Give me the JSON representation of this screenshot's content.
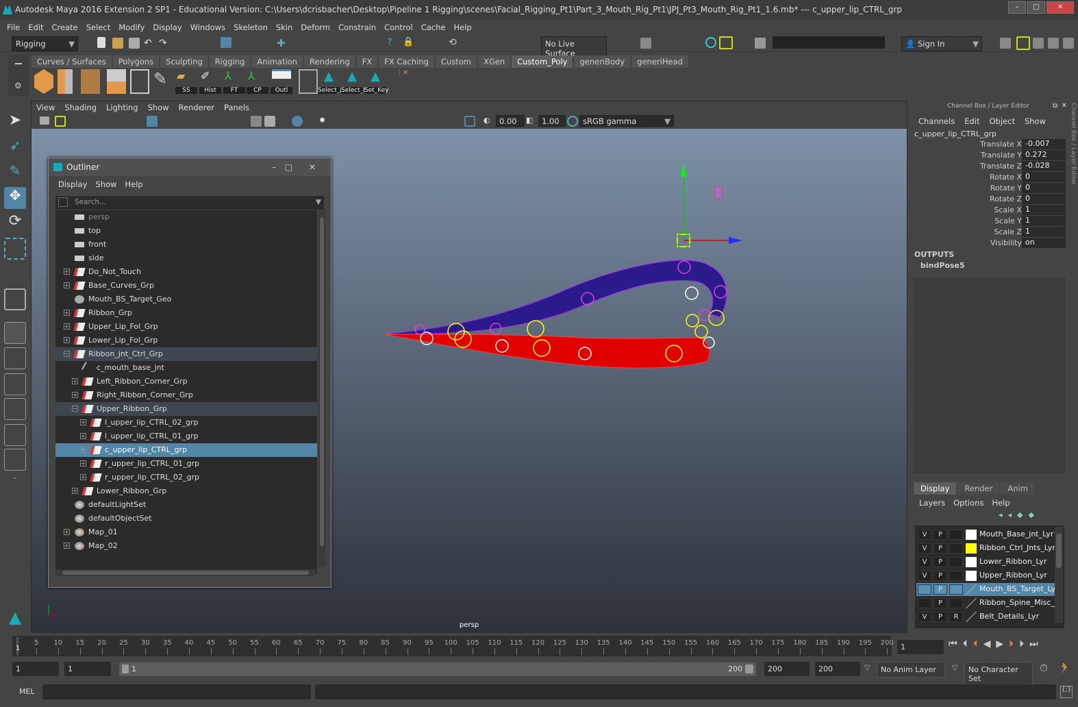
{
  "title": "Autodesk Maya 2016 Extension 2 SP1 - Educational Version: C:\\Users\\dcrisbacher\\Desktop\\Pipeline 1 Rigging\\scenes\\Facial_Rigging_Pt1\\Part_3_Mouth_Rig_Pt1\\JPJ_Pt3_Mouth_Rig_Pt1_1.6.mb*  ---  c_upper_lip_CTRL_grp",
  "menu": [
    "File",
    "Edit",
    "Create",
    "Select",
    "Modify",
    "Display",
    "Windows",
    "Skeleton",
    "Skin",
    "Deform",
    "Constrain",
    "Control",
    "Cache",
    "Help"
  ],
  "status": {
    "mode": "Rigging",
    "live_surface": "No Live Surface",
    "sign_in": "Sign In"
  },
  "shelf_tabs": [
    "Curves / Surfaces",
    "Polygons",
    "Sculpting",
    "Rigging",
    "Animation",
    "Rendering",
    "FX",
    "FX Caching",
    "Custom",
    "XGen",
    "Custom_Poly",
    "generiBody",
    "generiHead"
  ],
  "shelf_active": "Custom_Poly",
  "shelf_labels": [
    "SS",
    "Hist",
    "FT",
    "CP",
    "Outl",
    "Select_/",
    "Select_I",
    "Set_Key"
  ],
  "viewport": {
    "menu": [
      "View",
      "Shading",
      "Lighting",
      "Show",
      "Renderer",
      "Panels"
    ],
    "exposure": "0.00",
    "gamma": "1.00",
    "color_space": "sRGB gamma",
    "camera": "persp"
  },
  "outliner": {
    "title": "Outliner",
    "menu": [
      "Display",
      "Show",
      "Help"
    ],
    "search_placeholder": "Search...",
    "items": [
      {
        "label": "persp",
        "level": 0,
        "type": "camera",
        "dim": true
      },
      {
        "label": "top",
        "level": 0,
        "type": "camera"
      },
      {
        "label": "front",
        "level": 0,
        "type": "camera"
      },
      {
        "label": "side",
        "level": 0,
        "type": "camera"
      },
      {
        "label": "Do_Not_Touch",
        "level": 0,
        "type": "group",
        "exp": "+"
      },
      {
        "label": "Base_Curves_Grp",
        "level": 0,
        "type": "group",
        "exp": "+"
      },
      {
        "label": "Mouth_BS_Target_Geo",
        "level": 0,
        "type": "mesh"
      },
      {
        "label": "Ribbon_Grp",
        "level": 0,
        "type": "group",
        "exp": "+"
      },
      {
        "label": "Upper_Lip_Fol_Grp",
        "level": 0,
        "type": "group",
        "exp": "+"
      },
      {
        "label": "Lower_Lip_Fol_Grp",
        "level": 0,
        "type": "group",
        "exp": "+"
      },
      {
        "label": "Ribbon_jnt_Ctrl_Grp",
        "level": 0,
        "type": "group",
        "exp": "-",
        "state": "hl"
      },
      {
        "label": "c_mouth_base_jnt",
        "level": 1,
        "type": "joint"
      },
      {
        "label": "Left_Ribbon_Corner_Grp",
        "level": 1,
        "type": "group",
        "exp": "+"
      },
      {
        "label": "Right_Ribbon_Corner_Grp",
        "level": 1,
        "type": "group",
        "exp": "+"
      },
      {
        "label": "Upper_Ribbon_Grp",
        "level": 1,
        "type": "group",
        "exp": "-",
        "state": "hl"
      },
      {
        "label": "l_upper_lip_CTRL_02_grp",
        "level": 2,
        "type": "group",
        "exp": "+"
      },
      {
        "label": "l_upper_lip_CTRL_01_grp",
        "level": 2,
        "type": "group",
        "exp": "+"
      },
      {
        "label": "c_upper_lip_CTRL_grp",
        "level": 2,
        "type": "group",
        "exp": "+",
        "state": "sel"
      },
      {
        "label": "r_upper_lip_CTRL_01_grp",
        "level": 2,
        "type": "group",
        "exp": "+"
      },
      {
        "label": "r_upper_lip_CTRL_02_grp",
        "level": 2,
        "type": "group",
        "exp": "+"
      },
      {
        "label": "Lower_Ribbon_Grp",
        "level": 1,
        "type": "group",
        "exp": "+"
      },
      {
        "label": "defaultLightSet",
        "level": 0,
        "type": "set"
      },
      {
        "label": "defaultObjectSet",
        "level": 0,
        "type": "set"
      },
      {
        "label": "Map_01",
        "level": 0,
        "type": "set",
        "exp": "+"
      },
      {
        "label": "Map_02",
        "level": 0,
        "type": "set",
        "exp": "+"
      }
    ]
  },
  "channel_box": {
    "title": "Channel Box / Layer Editor",
    "menu": [
      "Channels",
      "Edit",
      "Object",
      "Show"
    ],
    "object": "c_upper_lip_CTRL_grp",
    "channels": [
      {
        "name": "Translate X",
        "value": "-0.007"
      },
      {
        "name": "Translate Y",
        "value": "0.272"
      },
      {
        "name": "Translate Z",
        "value": "-0.028"
      },
      {
        "name": "Rotate X",
        "value": "0"
      },
      {
        "name": "Rotate Y",
        "value": "0"
      },
      {
        "name": "Rotate Z",
        "value": "0"
      },
      {
        "name": "Scale X",
        "value": "1"
      },
      {
        "name": "Scale Y",
        "value": "1"
      },
      {
        "name": "Scale Z",
        "value": "1"
      },
      {
        "name": "Visibility",
        "value": "on"
      }
    ],
    "outputs_label": "OUTPUTS",
    "outputs": [
      "bindPose5"
    ]
  },
  "layer_editor": {
    "tabs": [
      "Display",
      "Render",
      "Anim"
    ],
    "active_tab": "Display",
    "menu": [
      "Layers",
      "Options",
      "Help"
    ],
    "layers": [
      {
        "v": "V",
        "p": "P",
        "r": "",
        "name": "Mouth_Base_jnt_Lyr",
        "color": "#ffffff"
      },
      {
        "v": "V",
        "p": "P",
        "r": "",
        "name": "Ribbon_Ctrl_Jnts_Lyr",
        "color": "#ffff00"
      },
      {
        "v": "V",
        "p": "P",
        "r": "",
        "name": "Lower_Ribbon_Lyr",
        "color": "#ffffff"
      },
      {
        "v": "V",
        "p": "P",
        "r": "",
        "name": "Upper_Ribbon_Lyr",
        "color": "#ffffff"
      },
      {
        "v": "",
        "p": "P",
        "r": "",
        "name": "Mouth_BS_Target_Lyr",
        "color": "",
        "selected": true
      },
      {
        "v": "",
        "p": "P",
        "r": "",
        "name": "Ribbon_Spine_Misc_Ly",
        "color": ""
      },
      {
        "v": "V",
        "p": "P",
        "r": "R",
        "name": "Belt_Details_Lyr",
        "color": ""
      }
    ]
  },
  "timeline": {
    "start_label": "1",
    "ticks": [
      5,
      10,
      15,
      20,
      25,
      30,
      35,
      40,
      45,
      50,
      55,
      60,
      65,
      70,
      75,
      80,
      85,
      90,
      95,
      100,
      105,
      110,
      115,
      120,
      125,
      130,
      135,
      140,
      145,
      150,
      155,
      160,
      165,
      170,
      175,
      180,
      185,
      190,
      195,
      200
    ],
    "current_frame": "1"
  },
  "range": {
    "start": "1",
    "playback_start": "1",
    "slider_start": "1",
    "slider_end": "200",
    "playback_end": "200",
    "end": "200",
    "anim_layer": "No Anim Layer",
    "character_set": "No Character Set"
  },
  "command": {
    "label": "MEL"
  }
}
